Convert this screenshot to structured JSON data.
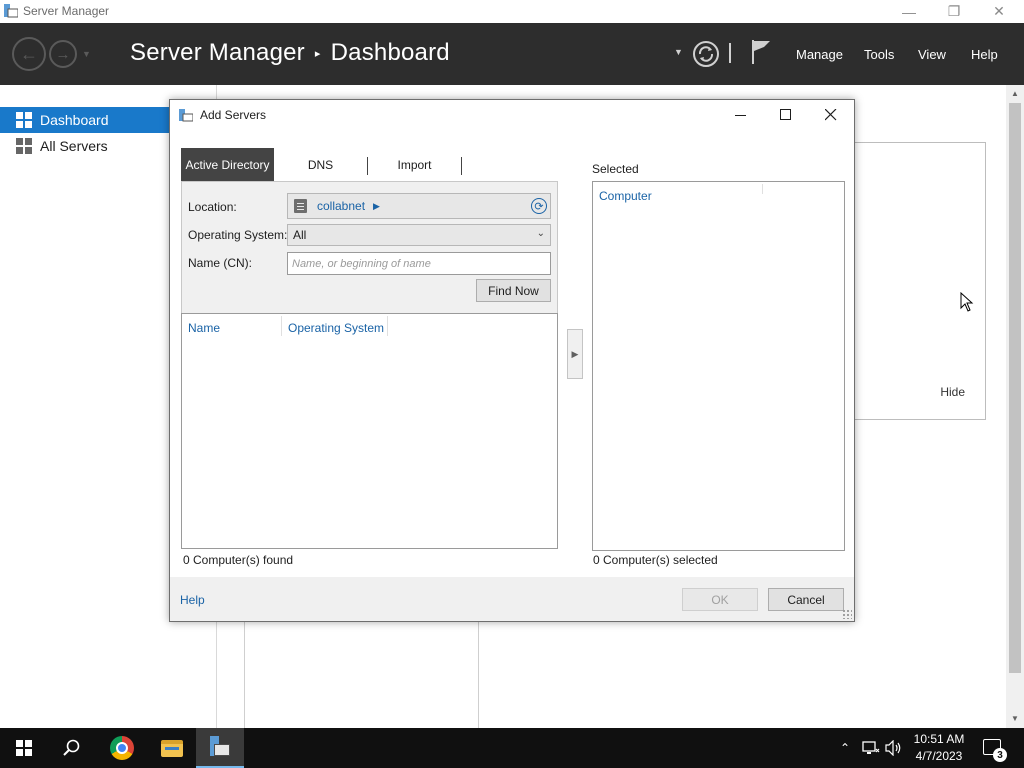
{
  "window": {
    "title": "Server Manager",
    "controls": {
      "minimize": "—",
      "restore": "❐",
      "close": "✕"
    }
  },
  "header": {
    "app_name": "Server Manager",
    "separator": "▸",
    "page": "Dashboard",
    "menus": [
      "Manage",
      "Tools",
      "View",
      "Help"
    ],
    "icons": [
      "back-icon",
      "forward-icon",
      "refresh-icon",
      "flag-icon"
    ]
  },
  "sidebar": {
    "items": [
      {
        "label": "Dashboard",
        "icon": "dashboard-icon",
        "active": true
      },
      {
        "label": "All Servers",
        "icon": "servers-icon",
        "active": false
      }
    ]
  },
  "content": {
    "welcome_hide": "Hide"
  },
  "dialog": {
    "title": "Add Servers",
    "tabs": [
      "Active Directory",
      "DNS",
      "Import"
    ],
    "active_tab": "Active Directory",
    "location_label": "Location:",
    "location_value": "collabnet",
    "os_label": "Operating System:",
    "os_value": "All",
    "name_label": "Name (CN):",
    "name_placeholder": "Name, or beginning of name",
    "find_now": "Find Now",
    "columns": [
      "Name",
      "Operating System"
    ],
    "found_status": "0 Computer(s) found",
    "selected_label": "Selected",
    "selected_column": "Computer",
    "selected_status": "0 Computer(s) selected",
    "help": "Help",
    "ok": "OK",
    "cancel": "Cancel"
  },
  "taskbar": {
    "apps": [
      "start-icon",
      "search-icon",
      "chrome-icon",
      "file-explorer-icon",
      "server-manager-icon"
    ],
    "time": "10:51 AM",
    "date": "4/7/2023",
    "notification_count": "3"
  },
  "colors": {
    "header_bg": "#2d2d2d",
    "accent": "#1979ca",
    "link": "#1a63a6",
    "taskbar_bg": "#101010"
  }
}
